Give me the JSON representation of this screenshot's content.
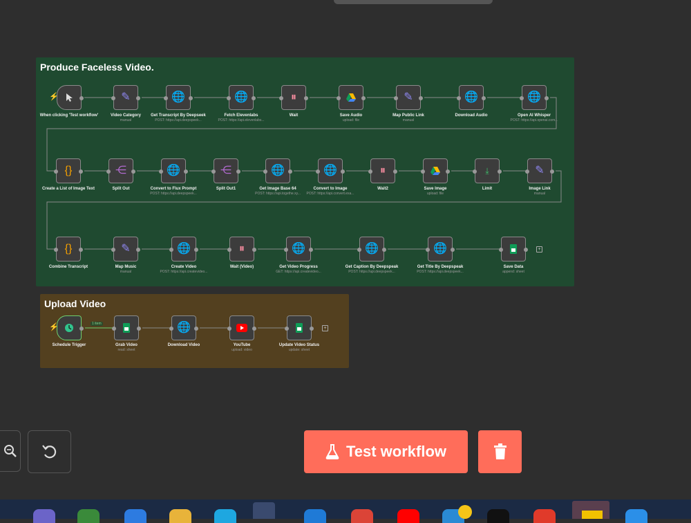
{
  "groups": [
    {
      "title": "Produce Faceless Video."
    },
    {
      "title": "Upload Video"
    }
  ],
  "nodes": [
    {
      "label": "When clicking 'Test workflow'",
      "sub": ""
    },
    {
      "label": "Video Category",
      "sub": "manual"
    },
    {
      "label": "Get Transcript By Deepseek",
      "sub": "POST: https://api.deepspeek..."
    },
    {
      "label": "Fetch Elevenlabs",
      "sub": "POST: https://api.elevenlabs..."
    },
    {
      "label": "Wait",
      "sub": ""
    },
    {
      "label": "Save Audio",
      "sub": "upload: file"
    },
    {
      "label": "Map Public Link",
      "sub": "manual"
    },
    {
      "label": "Download Audio",
      "sub": ""
    },
    {
      "label": "Open AI Whisper",
      "sub": "POST: https://api.openai.com..."
    },
    {
      "label": "Create a List of Image Text",
      "sub": ""
    },
    {
      "label": "Split Out",
      "sub": ""
    },
    {
      "label": "Convert to Flux Prompt",
      "sub": "POST: https://api.deepspeek..."
    },
    {
      "label": "Split Out1",
      "sub": ""
    },
    {
      "label": "Get Image Base 64",
      "sub": "POST: https://api.togethe.xy..."
    },
    {
      "label": "Convert to Image",
      "sub": "POST: https://api.convert.exa..."
    },
    {
      "label": "Wait2",
      "sub": ""
    },
    {
      "label": "Save Image",
      "sub": "upload: file"
    },
    {
      "label": "Limit",
      "sub": ""
    },
    {
      "label": "Image Link",
      "sub": "manual"
    },
    {
      "label": "Combine Transcript",
      "sub": ""
    },
    {
      "label": "Map Music",
      "sub": "manual"
    },
    {
      "label": "Create Video",
      "sub": "POST: https://api.createvideo..."
    },
    {
      "label": "Wait (Video)",
      "sub": ""
    },
    {
      "label": "Get Video Progress",
      "sub": "GET: https://api.createvideo..."
    },
    {
      "label": "Get Caption By Deepspeak",
      "sub": "POST: https://api.deepspeek..."
    },
    {
      "label": "Get Title By Deepspeak",
      "sub": "POST: https://api.deepspeek..."
    },
    {
      "label": "Save Data",
      "sub": "append: sheet"
    },
    {
      "label": "Schedule Trigger",
      "sub": ""
    },
    {
      "label": "Grab Video",
      "sub": "read: sheet"
    },
    {
      "label": "Download Video",
      "sub": ""
    },
    {
      "label": "YouTube",
      "sub": "upload: video"
    },
    {
      "label": "Update Video Status",
      "sub": "update: sheet"
    }
  ],
  "connection_badge": "1 item",
  "toolbar": {
    "test_label": "Test workflow"
  },
  "icons": {
    "http": "globe-icon",
    "edit": "pencil-icon",
    "wait": "pause-icon",
    "drive": "google-drive-icon",
    "code": "braces-icon",
    "split": "split-icon",
    "limit": "limit-icon",
    "sheets": "google-sheets-icon",
    "youtube": "youtube-icon",
    "schedule": "clock-icon",
    "manual": "cursor-icon"
  },
  "colors": {
    "accent": "#ff6d5a",
    "group1_bg": "#1f4a30",
    "group2_bg": "#53401f",
    "canvas_bg": "#2e2e2e"
  }
}
